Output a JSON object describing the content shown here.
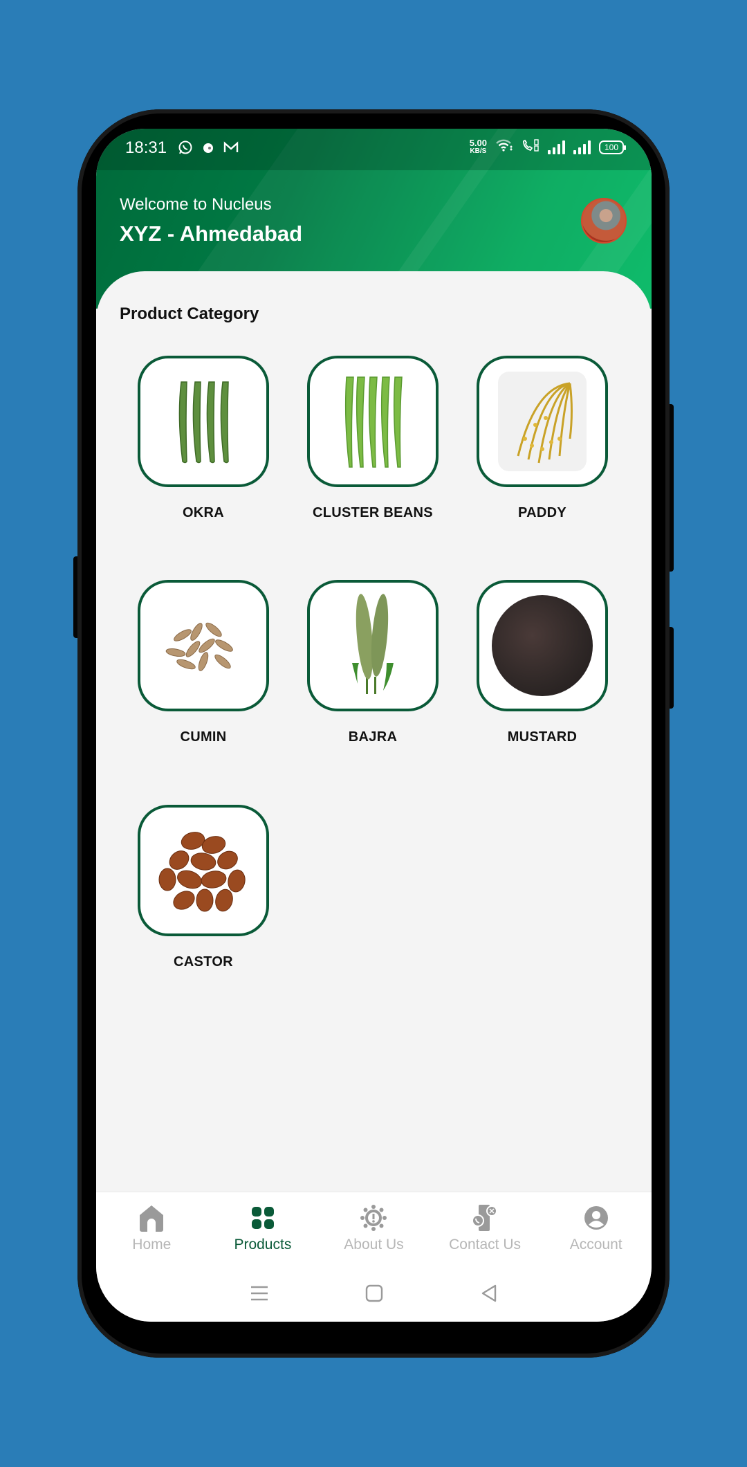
{
  "status_bar": {
    "time": "18:31",
    "left_icons": [
      "whatsapp-icon",
      "notification-dot-icon",
      "gmail-icon"
    ],
    "net_speed": "5.00",
    "net_speed_unit": "KB/S",
    "battery": "100"
  },
  "header": {
    "welcome": "Welcome to Nucleus",
    "company": "XYZ - Ahmedabad"
  },
  "section_title": "Product Category",
  "products": [
    {
      "label": "OKRA",
      "icon": "okra-image"
    },
    {
      "label": "CLUSTER BEANS",
      "icon": "cluster-beans-image"
    },
    {
      "label": "PADDY",
      "icon": "paddy-image"
    },
    {
      "label": "CUMIN",
      "icon": "cumin-image"
    },
    {
      "label": "BAJRA",
      "icon": "bajra-image"
    },
    {
      "label": "MUSTARD",
      "icon": "mustard-image"
    },
    {
      "label": "CASTOR",
      "icon": "castor-image"
    }
  ],
  "bottom_nav": [
    {
      "label": "Home",
      "icon": "home-icon",
      "active": false
    },
    {
      "label": "Products",
      "icon": "grid-icon",
      "active": true
    },
    {
      "label": "About Us",
      "icon": "info-gear-icon",
      "active": false
    },
    {
      "label": "Contact Us",
      "icon": "contact-phone-icon",
      "active": false
    },
    {
      "label": "Account",
      "icon": "account-icon",
      "active": false
    }
  ],
  "colors": {
    "background": "#2a7db7",
    "primary": "#0a5a38",
    "header_gradient_start": "#006a3a",
    "header_gradient_end": "#00b862",
    "inactive_nav": "#b6b6b6"
  }
}
